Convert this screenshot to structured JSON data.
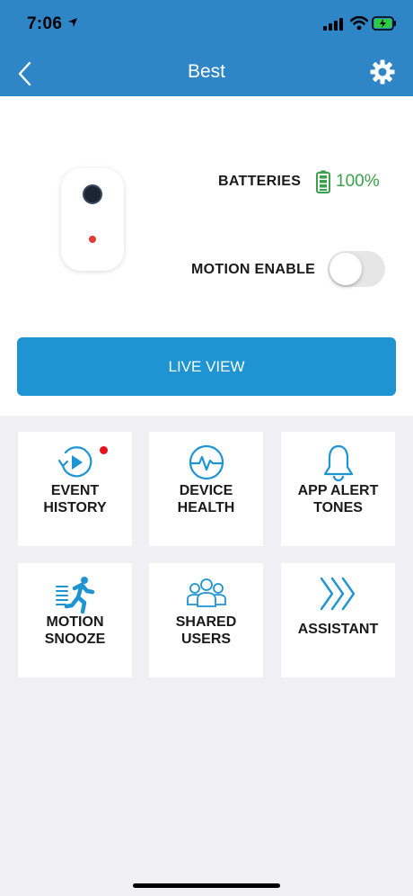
{
  "status_bar": {
    "time": "7:06"
  },
  "nav": {
    "title": "Best"
  },
  "device": {
    "batteries_label": "BATTERIES",
    "battery_percent": "100%",
    "battery_level": 1.0,
    "motion_label": "MOTION ENABLE",
    "motion_enabled": false,
    "live_view_label": "LIVE VIEW"
  },
  "tiles": [
    {
      "line1": "EVENT",
      "line2": "HISTORY",
      "icon": "event-history-icon",
      "has_badge": true
    },
    {
      "line1": "DEVICE",
      "line2": "HEALTH",
      "icon": "device-health-icon"
    },
    {
      "line1": "APP ALERT",
      "line2": "TONES",
      "icon": "bell-icon"
    },
    {
      "line1": "MOTION",
      "line2": "SNOOZE",
      "icon": "running-person-icon"
    },
    {
      "line1": "SHARED",
      "line2": "USERS",
      "icon": "users-icon"
    },
    {
      "line1": "ASSISTANT",
      "line2": "",
      "icon": "chevrons-right-icon"
    }
  ],
  "colors": {
    "header": "#2f86c6",
    "accent": "#1e94d3",
    "battery_green": "#3aa04a",
    "badge_red": "#e8121c",
    "background": "#efeff4"
  }
}
